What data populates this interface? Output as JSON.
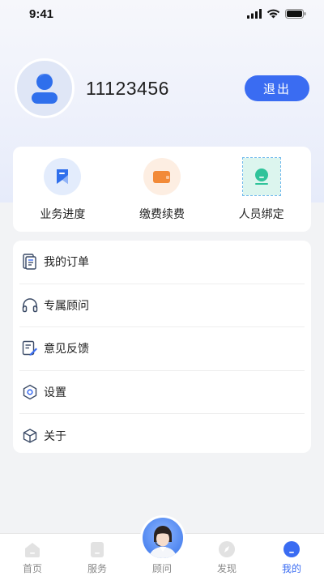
{
  "status_bar": {
    "time": "9:41"
  },
  "profile": {
    "username": "11123456",
    "logout_label": "退出"
  },
  "quick_actions": [
    {
      "label": "业务进度",
      "icon": "flag-icon",
      "color": "#2f6fec"
    },
    {
      "label": "缴费续费",
      "icon": "wallet-icon",
      "color": "#f28a38"
    },
    {
      "label": "人员绑定",
      "icon": "person-icon",
      "color": "#2fc39a"
    }
  ],
  "menu": [
    {
      "label": "我的订单",
      "icon": "order-icon"
    },
    {
      "label": "专属顾问",
      "icon": "headphones-icon"
    },
    {
      "label": "意见反馈",
      "icon": "feedback-icon"
    },
    {
      "label": "设置",
      "icon": "settings-icon"
    },
    {
      "label": "关于",
      "icon": "cube-icon"
    }
  ],
  "tab_bar": {
    "tabs": [
      {
        "label": "首页",
        "icon": "home-icon"
      },
      {
        "label": "服务",
        "icon": "service-icon"
      },
      {
        "label": "顾问",
        "icon": "advisor-avatar"
      },
      {
        "label": "发现",
        "icon": "discover-icon"
      },
      {
        "label": "我的",
        "icon": "profile-icon",
        "active": true
      }
    ],
    "active_color": "#3a6cf2"
  }
}
